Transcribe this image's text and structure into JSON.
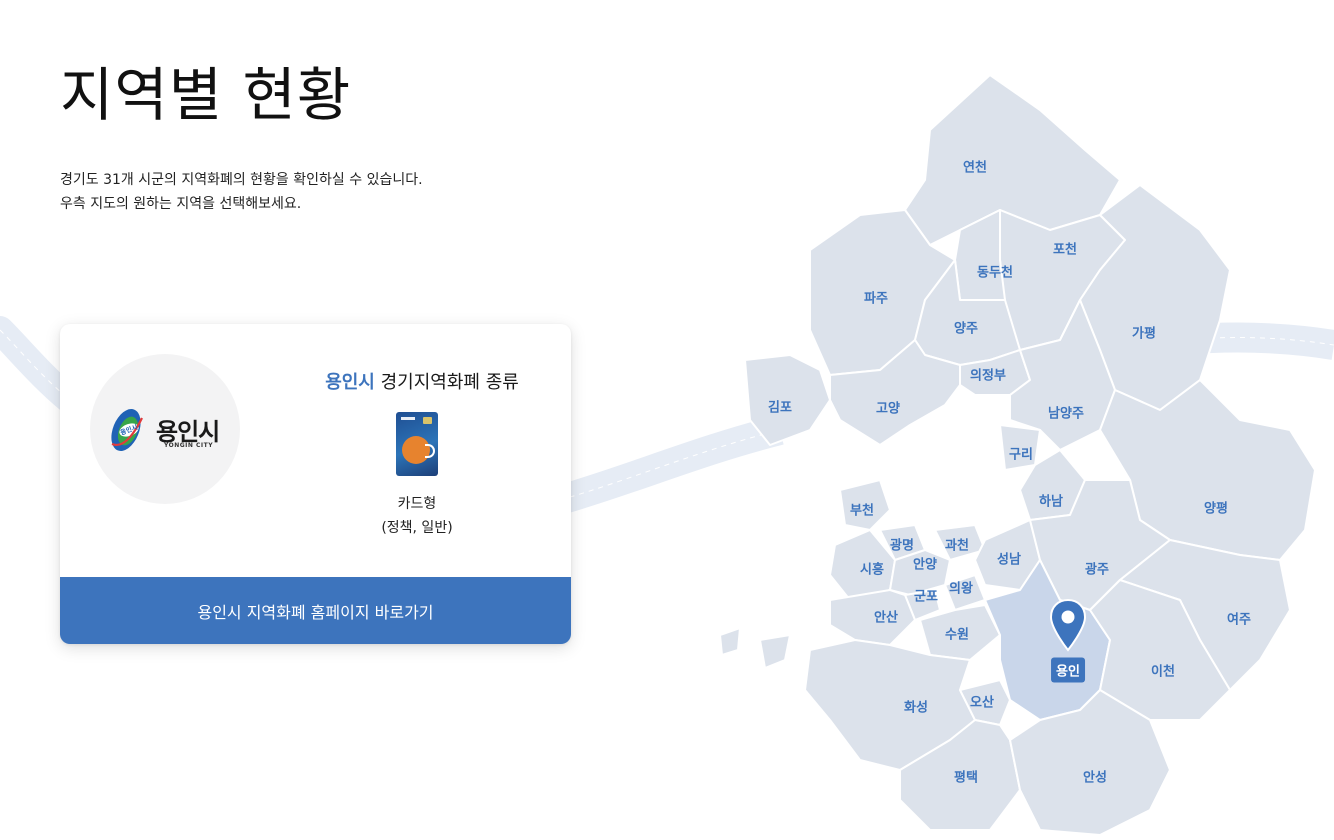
{
  "page": {
    "title": "지역별 현황",
    "intro_line1": "경기도 31개 시군의 지역화폐의 현황을 확인하실 수 있습니다.",
    "intro_line2": "우측 지도의 원하는 지역을 선택해보세요."
  },
  "card": {
    "logo_text": "용인시",
    "logo_mark_text": "용인시",
    "logo_subtext": "YONGIN CITY",
    "city": "용인시",
    "heading_suffix": "경기지역화폐 종류",
    "type_label": "카드형",
    "type_detail": "(정책, 일반)",
    "homepage_button": "용인시 지역화폐 홈페이지 바로가기"
  },
  "map": {
    "selected": "용인",
    "regions": [
      "연천",
      "포천",
      "동두천",
      "파주",
      "양주",
      "가평",
      "의정부",
      "김포",
      "고양",
      "남양주",
      "구리",
      "하남",
      "양평",
      "부천",
      "광명",
      "과천",
      "시흥",
      "안양",
      "성남",
      "광주",
      "군포",
      "의왕",
      "안산",
      "수원",
      "여주",
      "용인",
      "이천",
      "화성",
      "오산",
      "평택",
      "안성"
    ]
  },
  "colors": {
    "accent": "#3d74bd",
    "map_region": "#dce2eb",
    "map_border": "#ffffff",
    "ribbon": "#e6ecf5"
  },
  "icons": {
    "map_pin": "map-pin-icon",
    "logo": "yongin-city-logo"
  }
}
